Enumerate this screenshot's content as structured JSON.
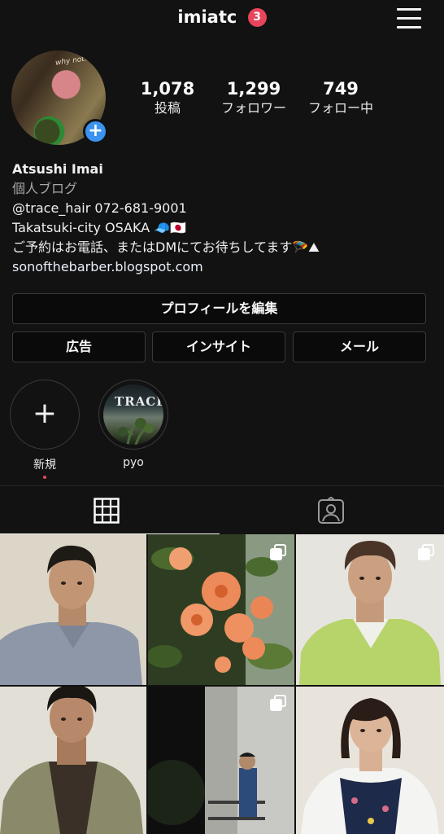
{
  "header": {
    "username": "imiatc",
    "notification_count": "3",
    "menu_icon": "hamburger-menu-icon"
  },
  "profile": {
    "avatar_caption": "why not?",
    "stats": [
      {
        "value": "1,078",
        "label": "投稿"
      },
      {
        "value": "1,299",
        "label": "フォロワー"
      },
      {
        "value": "749",
        "label": "フォロー中"
      }
    ],
    "name": "Atsushi Imai",
    "category": "個人ブログ",
    "bio_lines": [
      "@trace_hair 072-681-9001",
      "Takatsuki-city OSAKA 🧢🇯🇵",
      "ご予約はお電話、またはDMにてお待ちしてます🪂⛰"
    ],
    "website": "sonofthebarber.blogspot.com"
  },
  "buttons": {
    "edit_profile": "プロフィールを編集",
    "ads": "広告",
    "insights": "インサイト",
    "mail": "メール"
  },
  "highlights": [
    {
      "label": "新規",
      "type": "new"
    },
    {
      "label": "pyo",
      "type": "story",
      "cover_text": "TRACE"
    }
  ],
  "tabs": [
    {
      "icon": "grid-icon",
      "active": true
    },
    {
      "icon": "tagged-person-icon",
      "active": false
    }
  ],
  "posts": [
    {
      "subject": "man in gray shirt portrait",
      "multi": false
    },
    {
      "subject": "orange trumpet flowers",
      "multi": true
    },
    {
      "subject": "man in green shirt portrait",
      "multi": true
    },
    {
      "subject": "man in vest portrait",
      "multi": false
    },
    {
      "subject": "man on balcony at night",
      "multi": true
    },
    {
      "subject": "woman in knit vest portrait",
      "multi": false
    }
  ],
  "colors": {
    "background": "#121212",
    "badge": "#e8445a",
    "add_button": "#3a93f0"
  }
}
